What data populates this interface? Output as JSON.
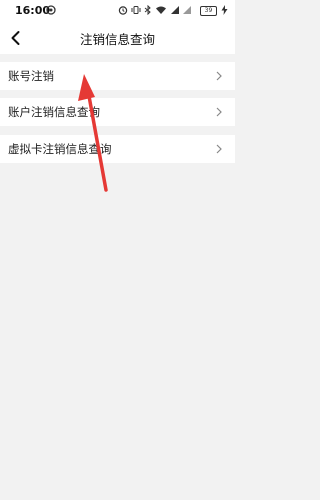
{
  "status_bar": {
    "time": "16:00",
    "battery": "39",
    "icons": [
      "notification-icon",
      "alarm-icon",
      "vibrate-icon",
      "bluetooth-icon",
      "wifi-icon",
      "signal-icon",
      "battery-icon",
      "charging-icon"
    ]
  },
  "header": {
    "title": "注销信息查询",
    "back_icon": "chevron-left-icon"
  },
  "menu": {
    "items": [
      {
        "label": "账号注销"
      },
      {
        "label": "账户注销信息查询"
      },
      {
        "label": "虚拟卡注销信息查询"
      }
    ]
  },
  "annotation": {
    "arrow_color": "#e53935"
  }
}
